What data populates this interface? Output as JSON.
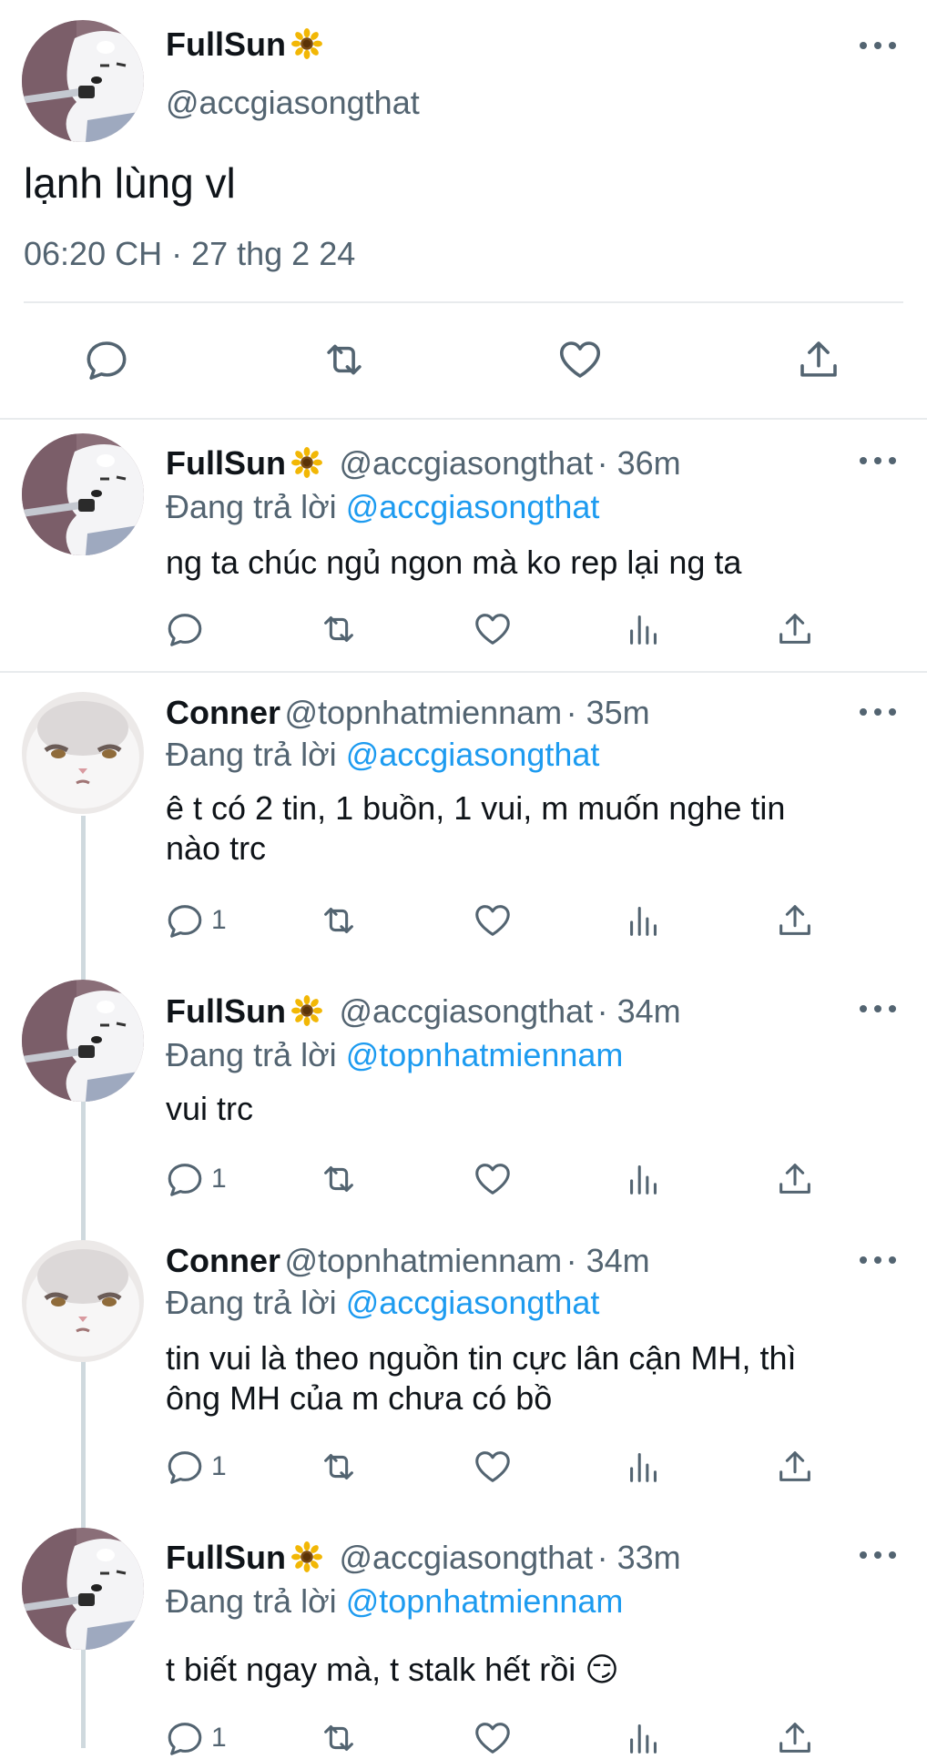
{
  "main_tweet": {
    "display_name": "FullSun",
    "handle": "@accgiasongthat",
    "text": "lạnh lùng vl",
    "timestamp": "06:20 CH · 27 thg 2 24"
  },
  "replies": [
    {
      "display_name": "FullSun",
      "handle": "@accgiasongthat",
      "time": "· 36m",
      "reply_prefix": "Đang trả lời",
      "reply_to": "@accgiasongthat",
      "lines": [
        "ng ta chúc ngủ ngon mà ko rep lại ng ta"
      ],
      "reply_count": ""
    },
    {
      "display_name": "Conner",
      "handle": "@topnhatmiennam",
      "time": "· 35m",
      "reply_prefix": "Đang trả lời",
      "reply_to": "@accgiasongthat",
      "lines": [
        "ê t có 2 tin, 1 buồn, 1 vui, m muốn nghe tin",
        "nào trc"
      ],
      "reply_count": "1"
    },
    {
      "display_name": "FullSun",
      "handle": "@accgiasongthat",
      "time": "· 34m",
      "reply_prefix": "Đang trả lời",
      "reply_to": "@topnhatmiennam",
      "lines": [
        "vui trc"
      ],
      "reply_count": "1"
    },
    {
      "display_name": "Conner",
      "handle": "@topnhatmiennam",
      "time": "· 34m",
      "reply_prefix": "Đang trả lời",
      "reply_to": "@accgiasongthat",
      "lines": [
        "tin vui là theo nguồn tin cực lân cận MH, thì",
        "ông MH của m chưa có bồ"
      ],
      "reply_count": "1"
    },
    {
      "display_name": "FullSun",
      "handle": "@accgiasongthat",
      "time": "· 33m",
      "reply_prefix": "Đang trả lời",
      "reply_to": "@topnhatmiennam",
      "lines": [
        "t biết ngay mà, t stalk hết rồi 😏"
      ],
      "reply_count": "1"
    }
  ],
  "icons": {
    "reply": "reply-icon",
    "retweet": "retweet-icon",
    "like": "like-icon",
    "analytics": "analytics-icon",
    "share": "share-icon",
    "more": "more-icon",
    "sunflower": "sunflower-icon"
  },
  "colors": {
    "text": "#0f1419",
    "secondary": "#536471",
    "accent": "#1d9bf0",
    "divider": "#e8ebed",
    "thread_line": "#cfd9de"
  }
}
